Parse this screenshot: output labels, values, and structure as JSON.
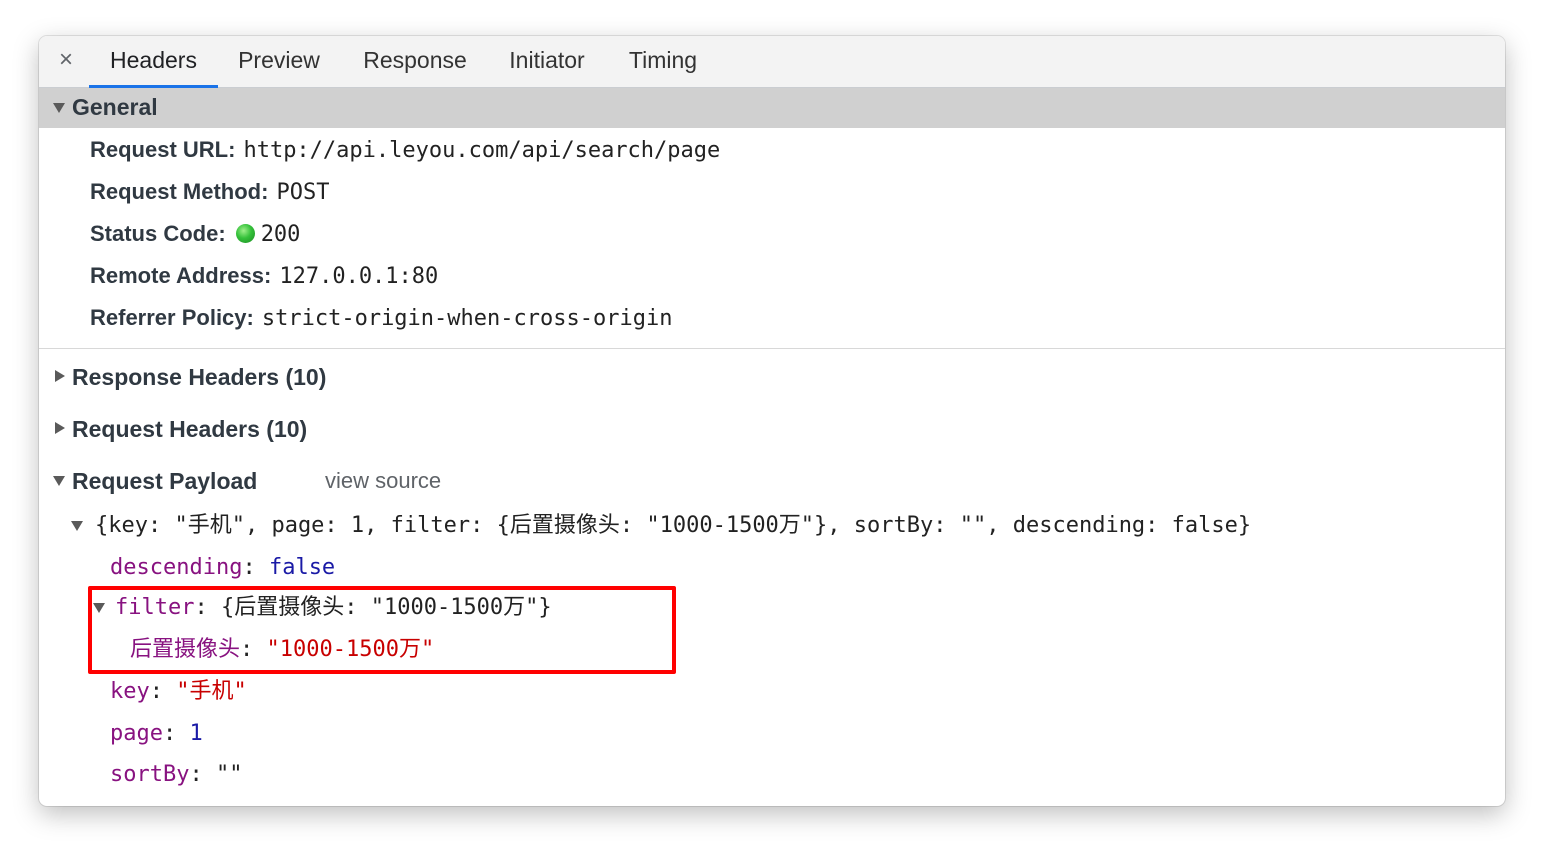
{
  "tabs": [
    {
      "label": "Headers",
      "active": true
    },
    {
      "label": "Preview",
      "active": false
    },
    {
      "label": "Response",
      "active": false
    },
    {
      "label": "Initiator",
      "active": false
    },
    {
      "label": "Timing",
      "active": false
    }
  ],
  "close_icon": "×",
  "general": {
    "title": "General",
    "rows": [
      {
        "key": "Request URL:",
        "value": "http://api.leyou.com/api/search/page"
      },
      {
        "key": "Request Method:",
        "value": "POST"
      },
      {
        "key": "Status Code:",
        "value": "200",
        "status_color": "#34c13a"
      },
      {
        "key": "Remote Address:",
        "value": "127.0.0.1:80"
      },
      {
        "key": "Referrer Policy:",
        "value": "strict-origin-when-cross-origin"
      }
    ]
  },
  "response_headers": {
    "title": "Response Headers (10)"
  },
  "request_headers": {
    "title": "Request Headers (10)"
  },
  "payload": {
    "title": "Request Payload",
    "view_source": "view source",
    "summary": "{key: \"手机\", page: 1, filter: {后置摄像头: \"1000-1500万\"}, sortBy: \"\", descending: false}",
    "descending": {
      "key": "descending",
      "value": "false"
    },
    "filter": {
      "key": "filter",
      "summary": "{后置摄像头: \"1000-1500万\"}",
      "child_key": "后置摄像头",
      "child_value": "\"1000-1500万\""
    },
    "key_field": {
      "key": "key",
      "value": "\"手机\""
    },
    "page": {
      "key": "page",
      "value": "1"
    },
    "sortBy": {
      "key": "sortBy",
      "value": "\"\""
    }
  },
  "colors": {
    "active_tab_underline": "#1a73e8",
    "highlight_border": "#ff0000",
    "payload_key": "#881280",
    "payload_number": "#1a1aa6",
    "payload_string": "#c80000"
  }
}
